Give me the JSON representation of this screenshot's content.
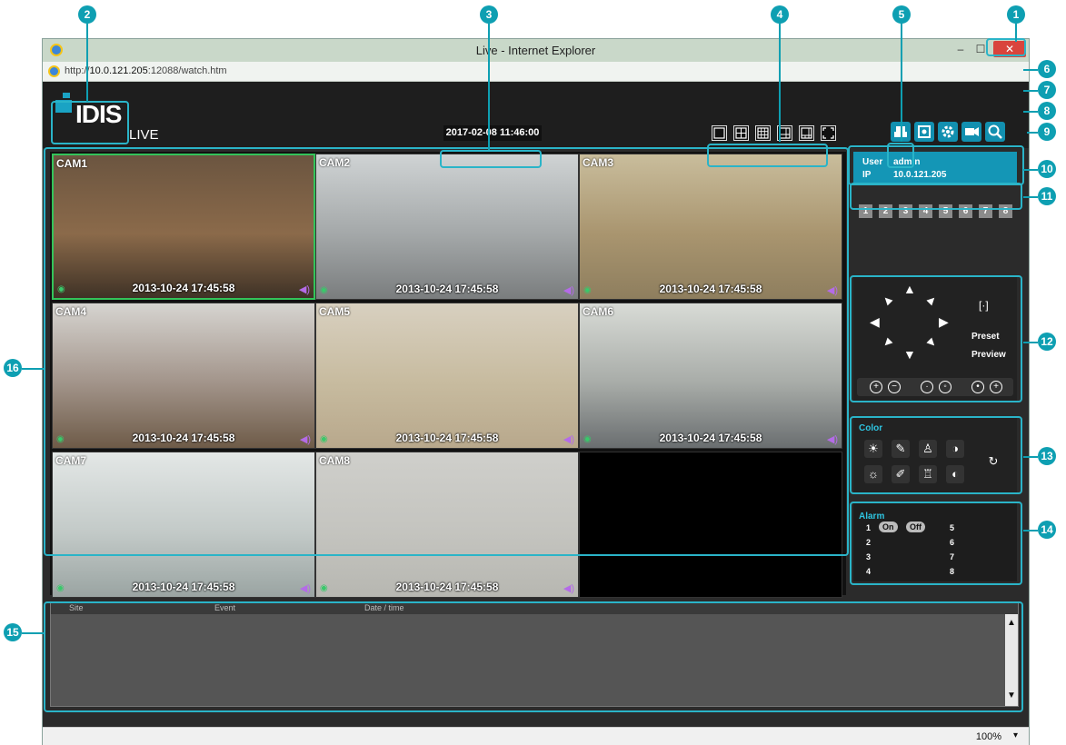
{
  "window": {
    "title": "Live - Internet Explorer",
    "url_prefix": "http://",
    "url_host": "10.0.121.205",
    "url_rest": ":12088/watch.htm",
    "min": "–",
    "max": "☐",
    "close": "✕"
  },
  "header": {
    "logo": "IDIS",
    "live": "LIVE",
    "datetime": "2017-02-08 11:46:00"
  },
  "cameras": [
    {
      "label": "CAM1",
      "timestamp": "2013-10-24 17:45:58",
      "sky": "#6b5540",
      "ground": "#3f3226",
      "mid": "#8b6a4a"
    },
    {
      "label": "CAM2",
      "timestamp": "2013-10-24 17:45:58",
      "sky": "#cfd3d4",
      "ground": "#7a7d7e",
      "mid": "#a4a8a9"
    },
    {
      "label": "CAM3",
      "timestamp": "2013-10-24 17:45:58",
      "sky": "#c9bd9c",
      "ground": "#8e7e5e",
      "mid": "#a9956f"
    },
    {
      "label": "CAM4",
      "timestamp": "2013-10-24 17:45:58",
      "sky": "#d6d4d0",
      "ground": "#6e5b48",
      "mid": "#a2948a"
    },
    {
      "label": "CAM5",
      "timestamp": "2013-10-24 17:45:58",
      "sky": "#d8d0c0",
      "ground": "#b8a88c",
      "mid": "#c7bb9f"
    },
    {
      "label": "CAM6",
      "timestamp": "2013-10-24 17:45:58",
      "sky": "#d8dbd6",
      "ground": "#6a6e70",
      "mid": "#a8aca8"
    },
    {
      "label": "CAM7",
      "timestamp": "2013-10-24 17:45:58",
      "sky": "#e3e7e6",
      "ground": "#9aa4a2",
      "mid": "#c3cac8"
    },
    {
      "label": "CAM8",
      "timestamp": "2013-10-24 17:45:58",
      "sky": "#cfcfcb",
      "ground": "#b7b7b1",
      "mid": "#c4c4bf"
    }
  ],
  "user_info": {
    "user_label": "User",
    "user_value": "admin",
    "ip_label": "IP",
    "ip_value": "10.0.121.205"
  },
  "channels": [
    "1",
    "2",
    "3",
    "4",
    "5",
    "6",
    "7",
    "8"
  ],
  "ptz": {
    "preset": "Preset",
    "preview": "Preview"
  },
  "color": {
    "title": "Color"
  },
  "alarm": {
    "title": "Alarm",
    "on": "On",
    "off": "Off",
    "rows": [
      "1",
      "2",
      "3",
      "4",
      "5",
      "6",
      "7",
      "8"
    ]
  },
  "event_log": {
    "columns": [
      "Site",
      "Event",
      "Date / time"
    ]
  },
  "status": {
    "zoom": "100%"
  },
  "callouts": [
    "1",
    "2",
    "3",
    "4",
    "5",
    "6",
    "7",
    "8",
    "9",
    "10",
    "11",
    "12",
    "13",
    "14",
    "15",
    "16"
  ]
}
